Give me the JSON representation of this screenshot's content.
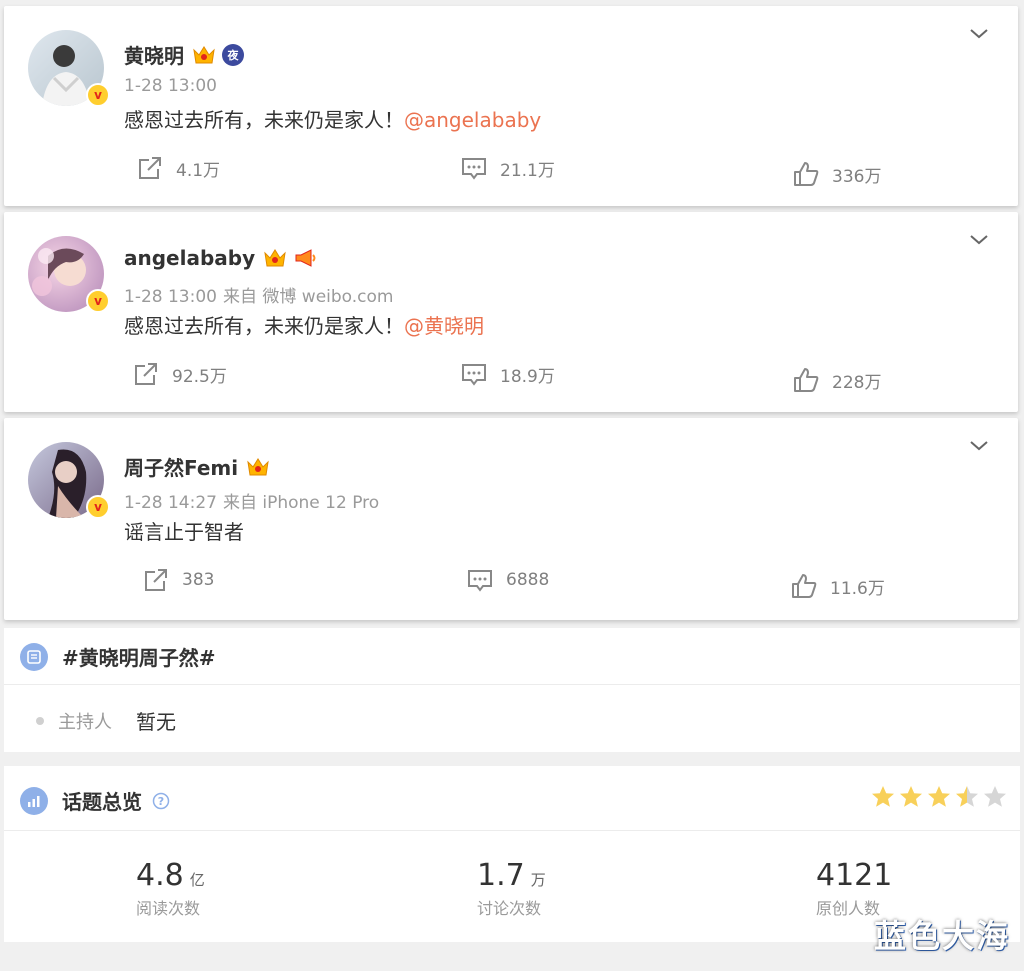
{
  "posts": [
    {
      "name": "黄晓明",
      "time": "1-28 13:00",
      "via": "",
      "text": "感恩过去所有，未来仍是家人！",
      "mention": "@angelababy",
      "reposts": "4.1万",
      "comments": "21.1万",
      "likes": "336万",
      "extra_badge": "夜",
      "badges": [
        "crown-icon",
        "night-badge-icon"
      ]
    },
    {
      "name": "angelababy",
      "time": "1-28 13:00",
      "via": "来自 微博 weibo.com",
      "text": "感恩过去所有，未来仍是家人！",
      "mention": "@黄晓明",
      "reposts": "92.5万",
      "comments": "18.9万",
      "likes": "228万",
      "badges": [
        "crown-icon",
        "megaphone-icon"
      ]
    },
    {
      "name": "周子然Femi",
      "time": "1-28 14:27",
      "via": "来自 iPhone 12 Pro",
      "text": "谣言止于智者",
      "mention": "",
      "reposts": "383",
      "comments": "6888",
      "likes": "11.6万",
      "badges": [
        "crown-icon"
      ]
    }
  ],
  "verified_badge": "v",
  "topic": {
    "title": "#黄晓明周子然#",
    "host_label": "主持人",
    "host_value": "暂无"
  },
  "overview": {
    "title": "话题总览",
    "rating_stars": 3.5,
    "rating_max": 5,
    "stats": [
      {
        "num": "4.8",
        "unit": "亿",
        "label": "阅读次数"
      },
      {
        "num": "1.7",
        "unit": "万",
        "label": "讨论次数"
      },
      {
        "num": "4121",
        "unit": "",
        "label": "原创人数"
      }
    ]
  },
  "watermark": "蓝色大海",
  "colors": {
    "mention": "#eb7350",
    "star_on": "#f8d05a",
    "star_off": "#d6d6d6",
    "section_icon": "#8fb0e8"
  }
}
